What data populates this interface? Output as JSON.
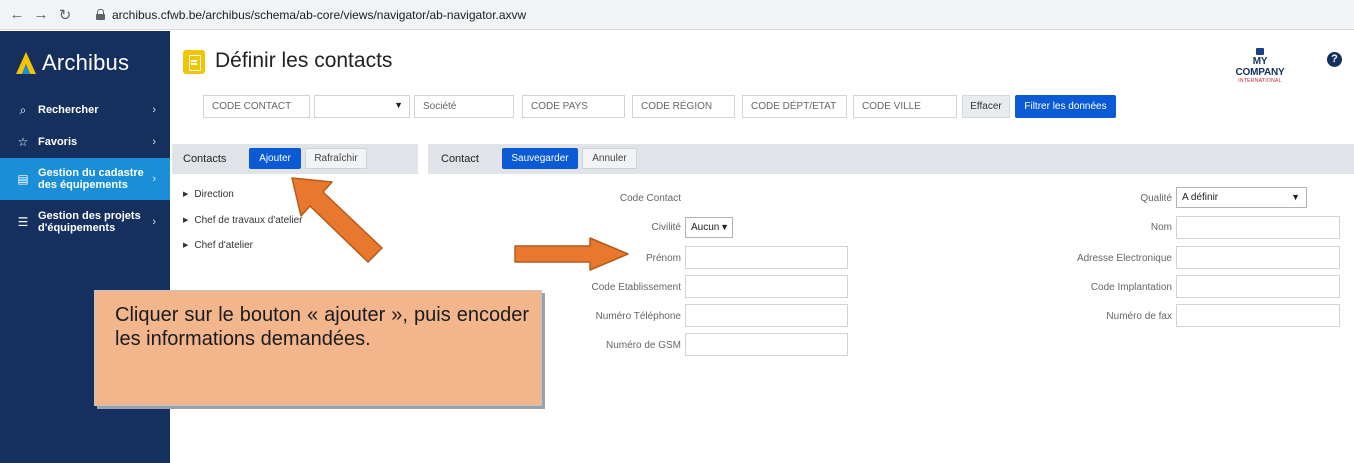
{
  "browser": {
    "url": "archibus.cfwb.be/archibus/schema/ab-core/views/navigator/ab-navigator.axvw"
  },
  "sidebar": {
    "logo": "Archibus",
    "items": [
      {
        "label": "Rechercher",
        "icon": "search-icon"
      },
      {
        "label": "Favoris",
        "icon": "star-icon"
      },
      {
        "label": "Gestion du cadastre des équipements",
        "line1": "Gestion du cadastre",
        "line2": "des équipements",
        "icon": "document-icon",
        "active": true
      },
      {
        "label": "Gestion des projets d'équipements",
        "line1": "Gestion des projets",
        "line2": "d'équipements",
        "icon": "gantt-icon"
      }
    ]
  },
  "header": {
    "title": "Définir les contacts",
    "company_name": "MY COMPANY",
    "company_sub": "INTERNATIONAL",
    "help": "?"
  },
  "filters": {
    "code_contact": "CODE CONTACT",
    "select_value": "",
    "societe": "Société",
    "code_pays": "CODE PAYS",
    "code_region": "CODE RÉGION",
    "code_dept": "CODE DÉPT/ETAT",
    "code_ville": "CODE VILLE",
    "clear_label": "Effacer",
    "filter_label": "Filtrer les données"
  },
  "contacts_panel": {
    "title": "Contacts",
    "add_label": "Ajouter",
    "refresh_label": "Rafraîchir",
    "tree": [
      "Direction",
      "Chef de travaux d'atelier",
      "Chef d'atelier"
    ]
  },
  "contact_form": {
    "title": "Contact",
    "save_label": "Sauvegarder",
    "cancel_label": "Annuler",
    "labels": {
      "code_contact": "Code Contact",
      "civilite": "Civilité",
      "prenom": "Prénom",
      "code_etablissement": "Code Etablissement",
      "numero_telephone": "Numéro Téléphone",
      "numero_gsm": "Numéro de GSM",
      "qualite": "Qualité",
      "nom": "Nom",
      "adresse_electronique": "Adresse Electronique",
      "code_implantation": "Code Implantation",
      "numero_fax": "Numéro de fax"
    },
    "civilite_value": "Aucun",
    "qualite_value": "A définir"
  },
  "callout": {
    "text": "Cliquer sur le bouton « ajouter », puis encoder les informations demandées."
  },
  "colors": {
    "sidebar": "#15305f",
    "sidebar_active": "#1a8fd8",
    "primary": "#0a5ad6",
    "callout": "#f2b58c",
    "arrow": "#e8782e",
    "title_icon": "#f5c400"
  }
}
